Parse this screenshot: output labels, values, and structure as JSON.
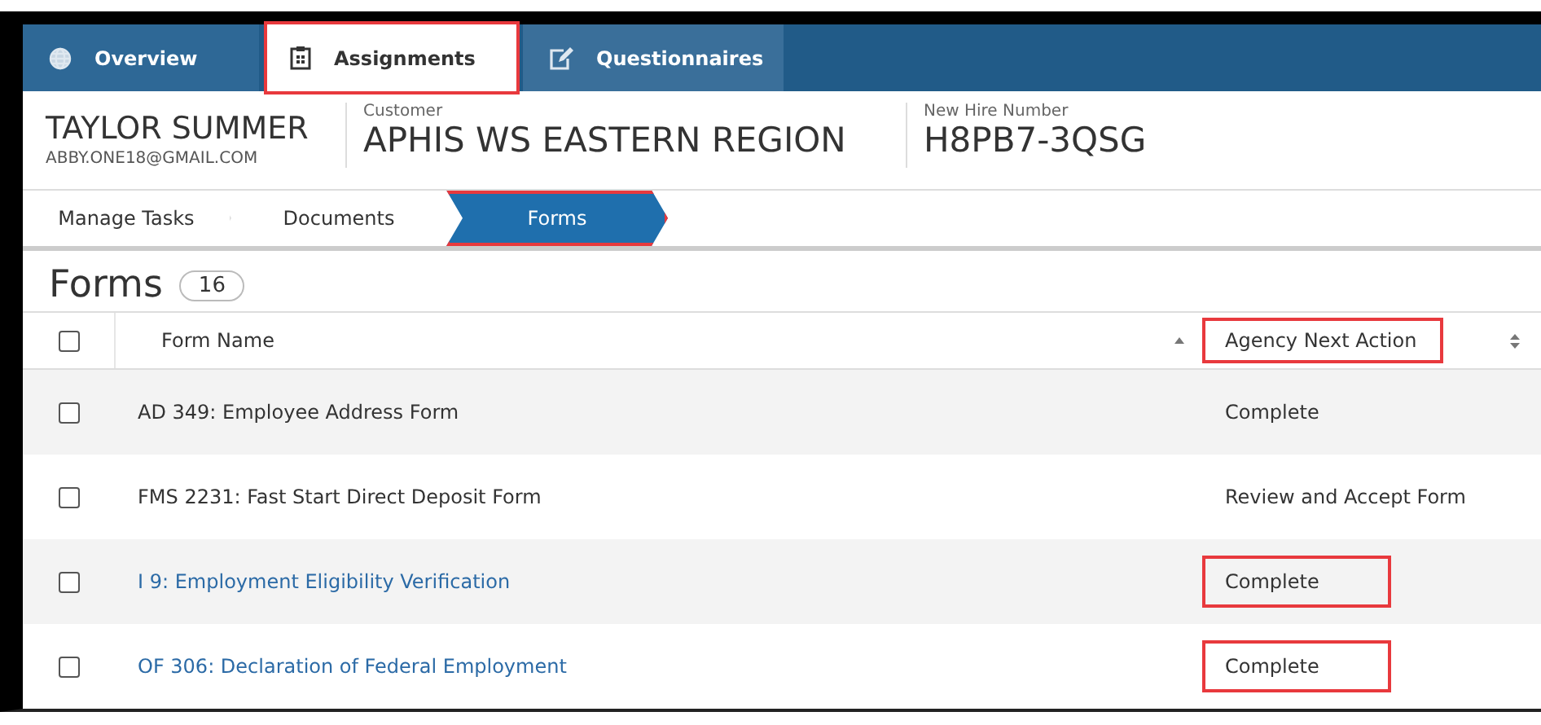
{
  "nav_tabs": [
    {
      "label": "Overview",
      "selected": false,
      "highlighted": false
    },
    {
      "label": "Assignments",
      "selected": true,
      "highlighted": true
    },
    {
      "label": "Questionnaires",
      "selected": false,
      "highlighted": false
    }
  ],
  "person": {
    "name": "TAYLOR SUMMER",
    "email": "ABBY.ONE18@GMAIL.COM"
  },
  "fields": [
    {
      "label": "Customer",
      "value": "APHIS WS EASTERN REGION"
    },
    {
      "label": "New Hire Number",
      "value": "H8PB7-3QSG"
    }
  ],
  "steps": [
    {
      "label": "Manage Tasks",
      "selected": false,
      "highlighted": false
    },
    {
      "label": "Documents",
      "selected": false,
      "highlighted": false
    },
    {
      "label": "Forms",
      "selected": true,
      "highlighted": true
    }
  ],
  "section": {
    "title": "Forms",
    "count": "16"
  },
  "table": {
    "select_all_checked": false,
    "columns": [
      {
        "label": "Form Name",
        "highlighted": false
      },
      {
        "label": "Agency Next Action",
        "highlighted": true
      }
    ],
    "rows": [
      {
        "checked": false,
        "name": "AD 349: Employee Address Form",
        "linked": false,
        "action": "Complete",
        "highlighted": false
      },
      {
        "checked": false,
        "name": "FMS 2231: Fast Start Direct Deposit Form",
        "linked": false,
        "action": "Review and Accept Form",
        "highlighted": false
      },
      {
        "checked": false,
        "name": "I 9: Employment Eligibility Verification",
        "linked": true,
        "action": "Complete",
        "highlighted": true
      },
      {
        "checked": false,
        "name": "OF 306: Declaration of Federal Employment",
        "linked": true,
        "action": "Complete",
        "highlighted": true
      }
    ]
  }
}
